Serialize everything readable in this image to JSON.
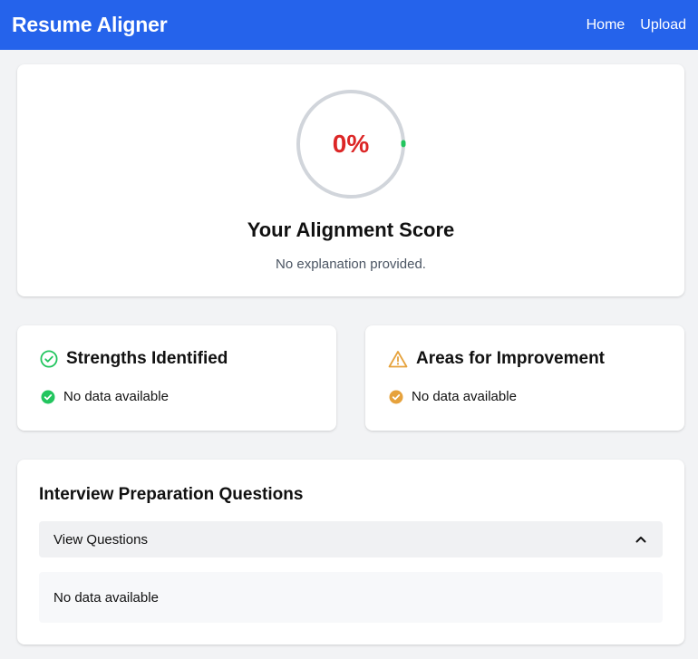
{
  "app": {
    "title": "Resume Aligner"
  },
  "nav": {
    "home": "Home",
    "upload": "Upload"
  },
  "score": {
    "value_text": "0%",
    "value_fraction": 0.0,
    "title": "Your Alignment Score",
    "explanation": "No explanation provided.",
    "colors": {
      "text": "#dc2626",
      "ring": "#d1d5db",
      "progress": "#22c55e"
    }
  },
  "strengths": {
    "title": "Strengths Identified",
    "icon": "check-circle-outline-icon",
    "items": [
      "No data available"
    ],
    "item_icon": "check-circle-filled-icon",
    "color": "#22c55e"
  },
  "improvements": {
    "title": "Areas for Improvement",
    "icon": "warning-triangle-icon",
    "items": [
      "No data available"
    ],
    "item_icon": "check-circle-filled-icon",
    "color": "#e6a23c"
  },
  "interview": {
    "title": "Interview Preparation Questions",
    "toggle_label": "View Questions",
    "toggle_icon": "chevron-up-icon",
    "content": "No data available"
  },
  "colors": {
    "navbar": "#2563eb",
    "background": "#f2f3f5"
  }
}
